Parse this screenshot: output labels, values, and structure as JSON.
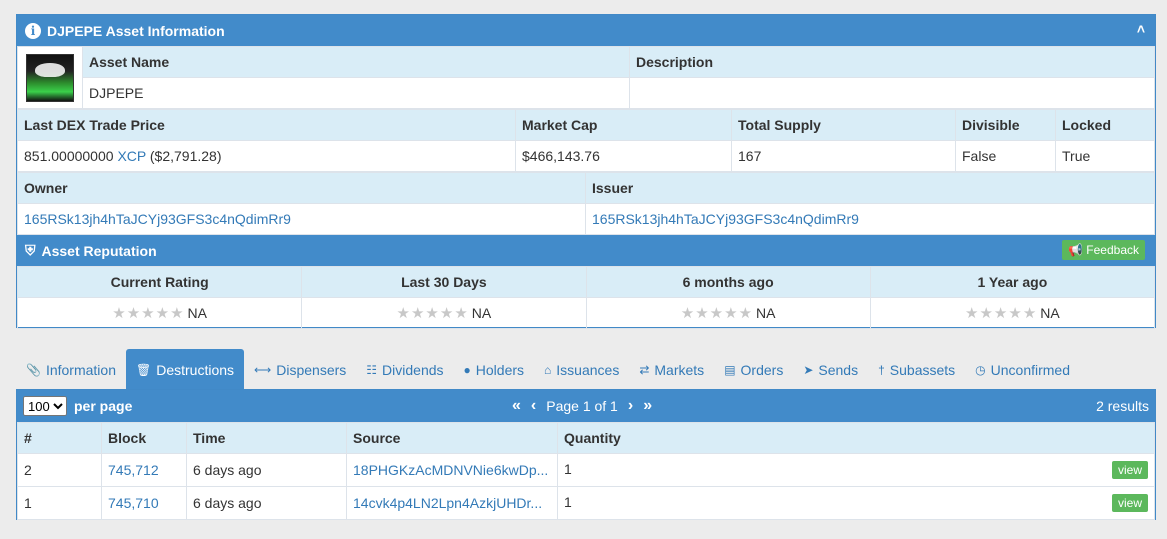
{
  "asset_panel": {
    "title": "DJPEPE Asset Information",
    "asset_name_label": "Asset Name",
    "asset_name": "DJPEPE",
    "description_label": "Description",
    "description": "",
    "price_label": "Last DEX Trade Price",
    "price_value": "851.00000000",
    "price_unit": "XCP",
    "price_usd": "($2,791.28)",
    "market_cap_label": "Market Cap",
    "market_cap": "$466,143.76",
    "total_supply_label": "Total Supply",
    "total_supply": "167",
    "divisible_label": "Divisible",
    "divisible": "False",
    "locked_label": "Locked",
    "locked": "True",
    "owner_label": "Owner",
    "owner": "165RSk13jh4hTaJCYj93GFS3c4nQdimRr9",
    "issuer_label": "Issuer",
    "issuer": "165RSk13jh4hTaJCYj93GFS3c4nQdimRr9"
  },
  "reputation": {
    "title": "Asset Reputation",
    "feedback_label": "Feedback",
    "columns": [
      "Current Rating",
      "Last 30 Days",
      "6 months ago",
      "1 Year ago"
    ],
    "values": [
      "NA",
      "NA",
      "NA",
      "NA"
    ]
  },
  "tabs": [
    {
      "label": "Information",
      "icon": "paperclip-icon"
    },
    {
      "label": "Destructions",
      "icon": "trash-icon"
    },
    {
      "label": "Dispensers",
      "icon": "arrows-horizontal-icon"
    },
    {
      "label": "Dividends",
      "icon": "sitemap-icon"
    },
    {
      "label": "Holders",
      "icon": "user-icon"
    },
    {
      "label": "Issuances",
      "icon": "bank-icon"
    },
    {
      "label": "Markets",
      "icon": "exchange-icon"
    },
    {
      "label": "Orders",
      "icon": "book-icon"
    },
    {
      "label": "Sends",
      "icon": "send-icon"
    },
    {
      "label": "Subassets",
      "icon": "child-icon"
    },
    {
      "label": "Unconfirmed",
      "icon": "clock-icon"
    }
  ],
  "results_panel": {
    "per_page_value": "100",
    "per_page_label": "per page",
    "page_text": "Page 1 of 1",
    "results_text": "2 results",
    "columns": [
      "#",
      "Block",
      "Time",
      "Source",
      "Quantity"
    ],
    "rows": [
      {
        "num": "2",
        "block": "745,712",
        "time": "6 days ago",
        "source": "18PHGKzAcMDNVNie6kwDp...",
        "quantity": "1",
        "action": "view"
      },
      {
        "num": "1",
        "block": "745,710",
        "time": "6 days ago",
        "source": "14cvk4p4LN2Lpn4AzkjUHDr...",
        "quantity": "1",
        "action": "view"
      }
    ]
  },
  "colors": {
    "primary": "#428bca",
    "header_bg": "#d9edf7",
    "success": "#5cb85c",
    "link": "#337ab7"
  }
}
